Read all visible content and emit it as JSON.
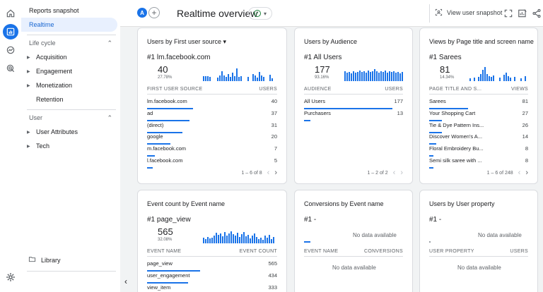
{
  "nav": {
    "top_item": "Reports snapshot",
    "active_item": "Realtime",
    "lifecycle": {
      "label": "Life cycle",
      "items": [
        "Acquisition",
        "Engagement",
        "Monetization"
      ],
      "plain_item": "Retention"
    },
    "user": {
      "label": "User",
      "items": [
        "User Attributes",
        "Tech"
      ]
    },
    "library": "Library"
  },
  "header": {
    "avatar_letter": "A",
    "add": "+",
    "title": "Realtime overview",
    "snapshot": "View user snapshot"
  },
  "cards": {
    "source": {
      "title": "Users by First user source",
      "rank_label": "#1 lm.facebook.com",
      "big": "40",
      "pct": "27.78%",
      "col1": "FIRST USER SOURCE",
      "col2": "USERS",
      "rows": [
        {
          "label": "lm.facebook.com",
          "value": "40",
          "share": 1.0
        },
        {
          "label": "ad",
          "value": "37",
          "share": 0.925
        },
        {
          "label": "(direct)",
          "value": "31",
          "share": 0.775
        },
        {
          "label": "google",
          "value": "20",
          "share": 0.5
        },
        {
          "label": "m.facebook.com",
          "value": "7",
          "share": 0.175
        },
        {
          "label": "l.facebook.com",
          "value": "5",
          "share": 0.125
        }
      ],
      "pager": "1 – 6 of 8"
    },
    "audience": {
      "title": "Users by Audience",
      "rank_label": "#1 All Users",
      "big": "177",
      "pct": "93.16%",
      "col1": "AUDIENCE",
      "col2": "USERS",
      "rows": [
        {
          "label": "All Users",
          "value": "177",
          "share": 1.0
        },
        {
          "label": "Purchasers",
          "value": "13",
          "share": 0.073
        }
      ],
      "pager": "1 – 2 of 2"
    },
    "pages": {
      "title": "Views by Page title and screen name",
      "rank_label": "#1 Sarees",
      "big": "81",
      "pct": "14.34%",
      "col1": "PAGE TITLE AND S...",
      "col2": "VIEWS",
      "rows": [
        {
          "label": "Sarees",
          "value": "81",
          "share": 1.0
        },
        {
          "label": "Your Shopping Cart",
          "value": "27",
          "share": 0.333
        },
        {
          "label": "Tie & Dye Pattern Ins...",
          "value": "26",
          "share": 0.321
        },
        {
          "label": "Discover Women's A...",
          "value": "14",
          "share": 0.173
        },
        {
          "label": "Floral Embroidery Bu...",
          "value": "8",
          "share": 0.099
        },
        {
          "label": "Semi silk saree with ...",
          "value": "8",
          "share": 0.099
        }
      ],
      "pager": "1 – 6 of 248"
    },
    "events": {
      "title": "Event count by Event name",
      "rank_label": "#1 page_view",
      "big": "565",
      "pct": "32.08%",
      "col1": "EVENT NAME",
      "col2": "EVENT COUNT",
      "rows": [
        {
          "label": "page_view",
          "value": "565",
          "share": 1.0
        },
        {
          "label": "user_engagement",
          "value": "434",
          "share": 0.768
        },
        {
          "label": "view_item",
          "value": "333",
          "share": 0.589
        }
      ]
    },
    "conversions": {
      "title": "Conversions by Event name",
      "rank_label": "#1 -",
      "nodata_top": "No data available",
      "col1": "EVENT NAME",
      "col2": "CONVERSIONS",
      "nodata_bottom": "No data available"
    },
    "property": {
      "title": "Users by User property",
      "rank_label": "#1 -",
      "nodata_top": "No data available",
      "col1": "USER PROPERTY",
      "col2": "USERS",
      "nodata_bottom": "No data available"
    }
  },
  "accent": "#1a73e8"
}
